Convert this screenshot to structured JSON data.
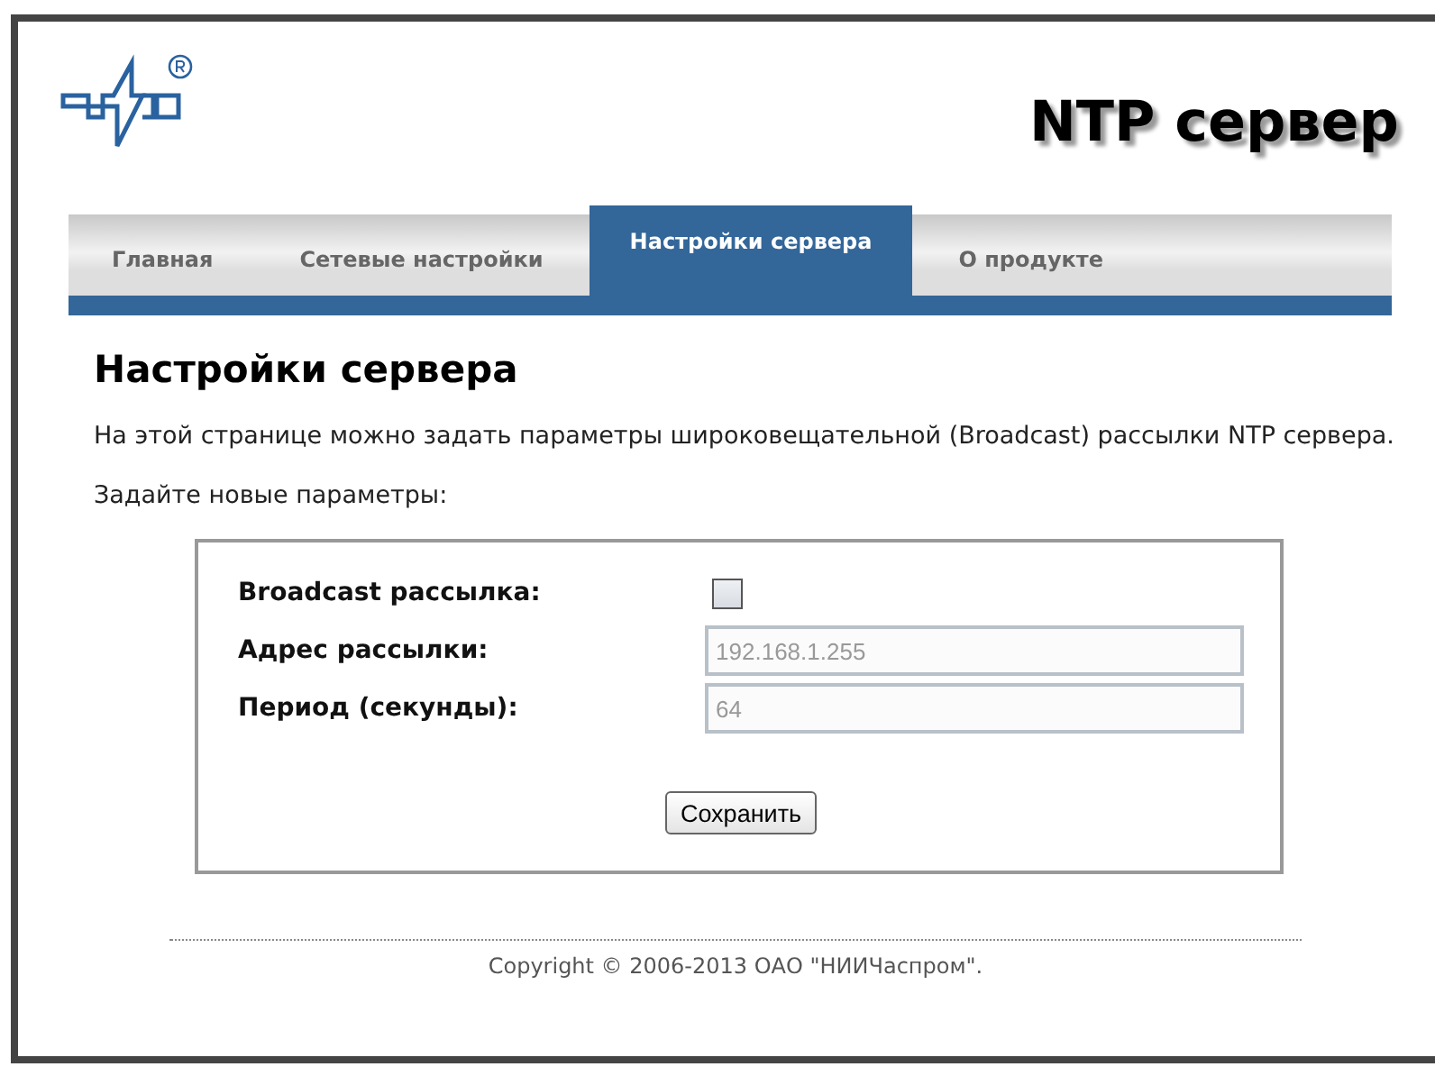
{
  "header": {
    "title": "NTP сервер"
  },
  "tabs": [
    {
      "label": "Главная",
      "selected": false
    },
    {
      "label": "Сетевые настройки",
      "selected": false
    },
    {
      "label": "Настройки сервера",
      "selected": true
    },
    {
      "label": "О продукте",
      "selected": false
    }
  ],
  "page": {
    "heading": "Настройки сервера",
    "description": "На этой странице можно задать параметры широковещательной (Broadcast) рассылки NTP сервера.",
    "prompt": "Задайте новые параметры:"
  },
  "form": {
    "fields": [
      {
        "kind": "checkbox",
        "label": "Broadcast рассылка:",
        "checked": false
      },
      {
        "kind": "text",
        "label": "Адрес рассылки:",
        "value": "192.168.1.255",
        "disabled": true
      },
      {
        "kind": "text",
        "label": "Период (секунды):",
        "value": "64",
        "disabled": true
      }
    ],
    "button": "Сохранить"
  },
  "footer": {
    "copyright": "Copyright © 2006-2013 ОАО \"НИИЧаспром\"."
  }
}
